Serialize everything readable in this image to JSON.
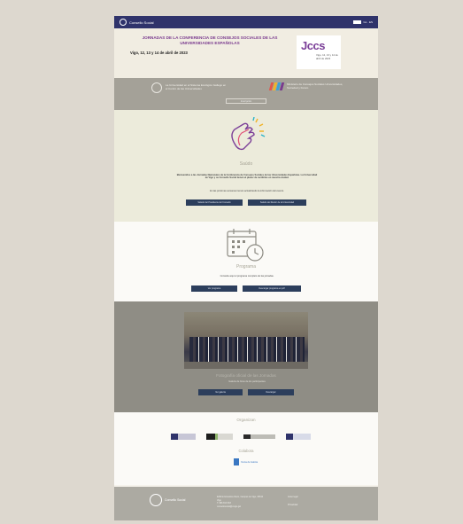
{
  "topbar": {
    "brand": "Consello Social",
    "brand_sub": "Universidade de Vigo",
    "lang": "GL · ES"
  },
  "hero": {
    "title": "JORNADAS DE LA CONFERENCIA DE CONSEJOS SOCIALES DE LAS UNIVERSIDADES ESPAÑOLAS",
    "date": "Vigo, 12, 13 y 14 de abril de 2023",
    "logo_text": "Jccs",
    "logo_sub": "Vigo, 12, 13 y 14 de abril de 2023"
  },
  "band": {
    "left_text": "La Universidad en el Sistema Ecológico Gallego en el Centro de las Universidades",
    "right_text": "Ministerio de Consejos Sociales Universidades, Sociedad y Futuro",
    "cta": "Inscripción"
  },
  "greeting": {
    "label": "Saúdo",
    "text_1": "Bienvenidos a las Jornadas Nacionales de la Conferencia de Consejos Sociales de las Universidades Españolas. La Universidad de Vigo y su Consello Social tienen el placer de recibirles en nuestra ciudad.",
    "text_2": "En las próximas semanas iremos actualizando la información del evento.",
    "btn_1": "Saludo del Presidente del Consello",
    "btn_2": "Saludo del Rector de la Universidad"
  },
  "program": {
    "label": "Programa",
    "text": "Consulte aquí el programa completo de las jornadas.",
    "btn_1": "Ver programa",
    "btn_2": "Descargar programa en pdf"
  },
  "photo_section": {
    "caption": "Fotografía oficial de las Jornadas",
    "sub": "Galería de fotos de los participantes",
    "btn_1": "Ver galería",
    "btn_2": "Descargar"
  },
  "organizers": {
    "label": "Organizan",
    "label_2": "Colabora",
    "collab": "Xunta de Galicia"
  },
  "footer": {
    "brand": "Consello Social",
    "address": "Edificio Ernestina Otero, Campus de Vigo, 36310 Vigo",
    "phone": "T. 986 813 633",
    "email": "consellosocial@uvigo.gal",
    "link_1": "Aviso legal",
    "link_2": "Privacidad"
  },
  "colors": {
    "navy": "#2f336b",
    "purple": "#7a3b8f",
    "button": "#2c3e5c"
  }
}
